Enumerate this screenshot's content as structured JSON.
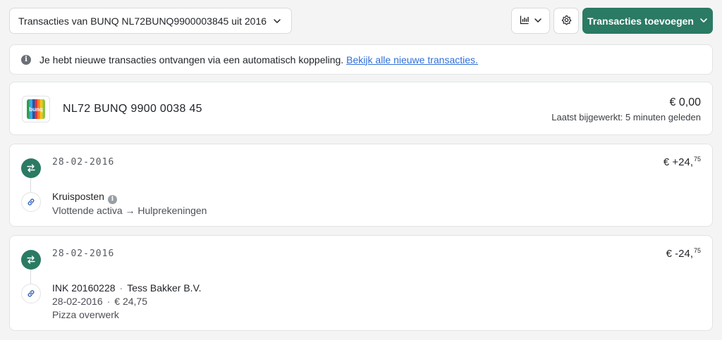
{
  "toolbar": {
    "account_select_label": "Transacties van BUNQ NL72BUNQ9900003845 uit 2016",
    "add_button_label": "Transacties toevoegen"
  },
  "notice": {
    "info_glyph": "i",
    "text": "Je hebt nieuwe transacties ontvangen via een automatisch koppeling.",
    "link_text": "Bekijk alle nieuwe transacties."
  },
  "account": {
    "logo_text": "bunq",
    "iban": "NL72 BUNQ 9900 0038 45",
    "balance": "€ 0,00",
    "updated": "Laatst bijgewerkt: 5 minuten geleden"
  },
  "transactions": [
    {
      "date": "28-02-2016",
      "amount_main": "€ +24,",
      "amount_cents": "75",
      "title": "Kruisposten",
      "info_glyph": "i",
      "subtitle": "Vlottende activa → Hulprekeningen"
    },
    {
      "date": "28-02-2016",
      "amount_main": "€ -24,",
      "amount_cents": "75",
      "ref": "INK 20160228",
      "separator": "·",
      "counterparty": "Tess Bakker B.V.",
      "booked_date": "28-02-2016",
      "booked_amount": "€ 24,75",
      "description": "Pizza overwerk"
    }
  ],
  "colors": {
    "brand_green": "#2b7a63",
    "link_blue": "#2f6fd6",
    "background": "#f4f4f5"
  },
  "icons": {
    "account_select": "chevron-down-icon",
    "chart": "bar-chart-icon",
    "settings": "gear-icon",
    "add": "chevron-down-icon",
    "notice": "info-icon",
    "transfer": "transfer-arrows-icon",
    "link": "link-icon"
  }
}
